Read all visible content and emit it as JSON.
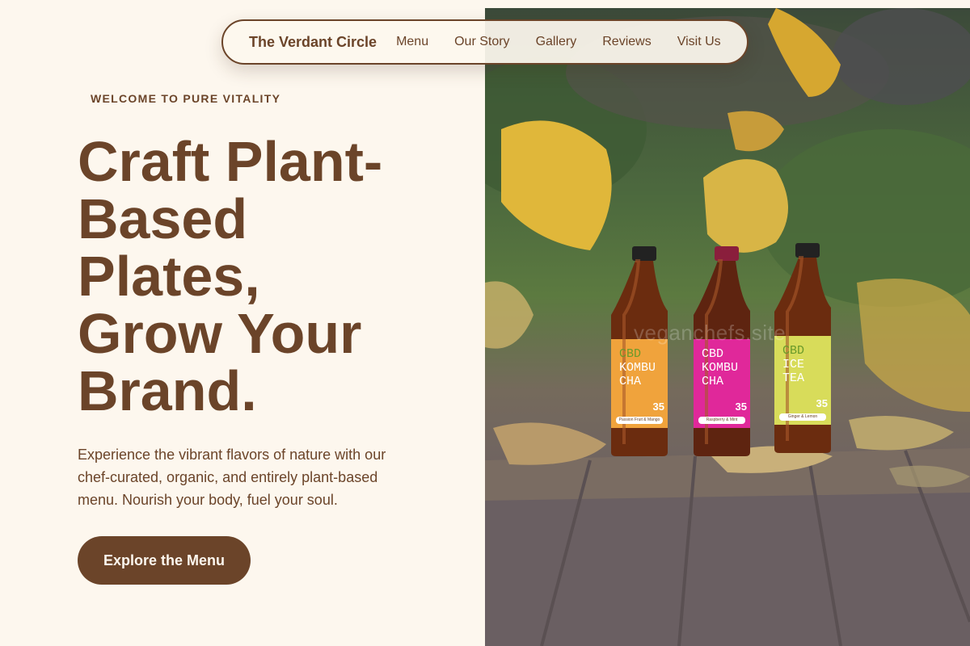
{
  "nav": {
    "brand": "The Verdant Circle",
    "links": [
      "Menu",
      "Our Story",
      "Gallery",
      "Reviews",
      "Visit Us"
    ]
  },
  "hero": {
    "eyebrow": "WELCOME TO PURE VITALITY",
    "headline_lines": [
      "Craft Plant-",
      "Based",
      "Plates,",
      "Grow Your",
      "Brand."
    ],
    "lead": "Experience the vibrant flavors of nature with our chef-curated, organic, and entirely plant-based menu. Nourish your body, fuel your soul.",
    "cta_label": "Explore the Menu"
  },
  "photo": {
    "watermark": "veganchefs.site",
    "bottles": [
      {
        "line1": "CBD",
        "line2": "KOMBU",
        "line3": "CHA",
        "dose": "35",
        "flavor": "Passion Fruit & Mango",
        "label_color": "#f0a33c"
      },
      {
        "line1": "CBD",
        "line2": "KOMBU",
        "line3": "CHA",
        "dose": "35",
        "flavor": "Raspberry & Mint",
        "label_color": "#e0289a"
      },
      {
        "line1": "CBD",
        "line2": "ICE",
        "line3": "TEA",
        "dose": "35",
        "flavor": "Ginger & Lemon",
        "label_color": "#d8dc5a"
      }
    ]
  },
  "colors": {
    "background": "#fdf7ee",
    "brand_brown": "#6b4429"
  }
}
